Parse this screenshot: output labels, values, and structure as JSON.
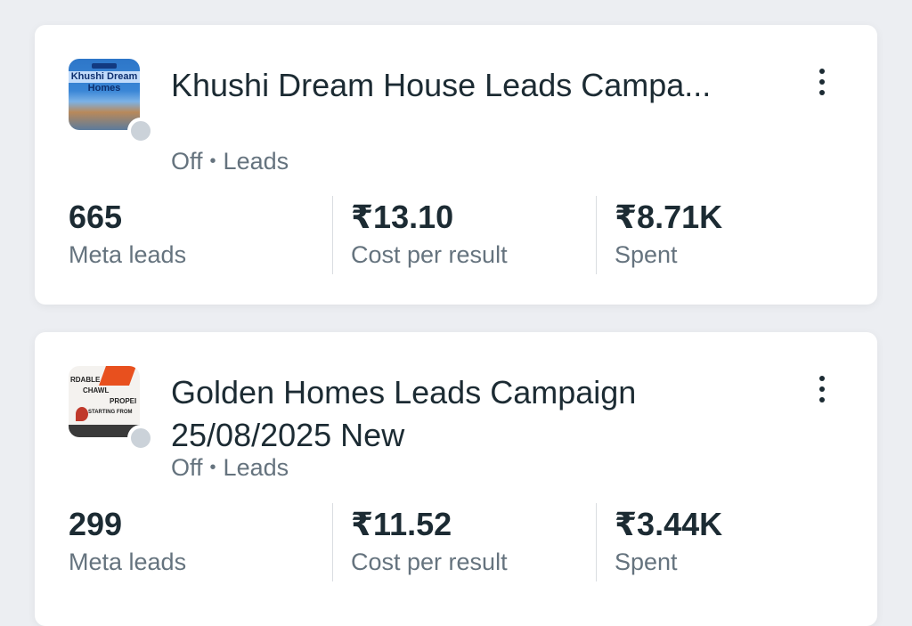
{
  "campaigns": [
    {
      "title": "Khushi Dream House Leads Campa...",
      "status": "Off",
      "objective": "Leads",
      "separator": "•",
      "thumbnail_text": [
        "Khushi Dream",
        "Homes"
      ],
      "metrics": [
        {
          "value": "665",
          "label": "Meta leads"
        },
        {
          "value": "₹13.10",
          "label": "Cost per result"
        },
        {
          "value": "₹8.71K",
          "label": "Spent"
        }
      ]
    },
    {
      "title": "Golden Homes Leads Campaign 25/08/2025  New",
      "status": "Off",
      "objective": "Leads",
      "separator": "•",
      "thumbnail_text": [
        "RDABLE",
        "CHAWL",
        "PROPEI",
        "STARTING FROM"
      ],
      "metrics": [
        {
          "value": "299",
          "label": "Meta leads"
        },
        {
          "value": "₹11.52",
          "label": "Cost per result"
        },
        {
          "value": "₹3.44K",
          "label": "Spent"
        }
      ]
    }
  ],
  "colors": {
    "text_primary": "#1c2b33",
    "text_secondary": "#65737e",
    "status_off": "#cbd2d9",
    "card_bg": "#ffffff",
    "page_bg": "#eceef2"
  },
  "icons": {
    "menu": "more-vertical-icon",
    "status": "status-dot-icon"
  }
}
